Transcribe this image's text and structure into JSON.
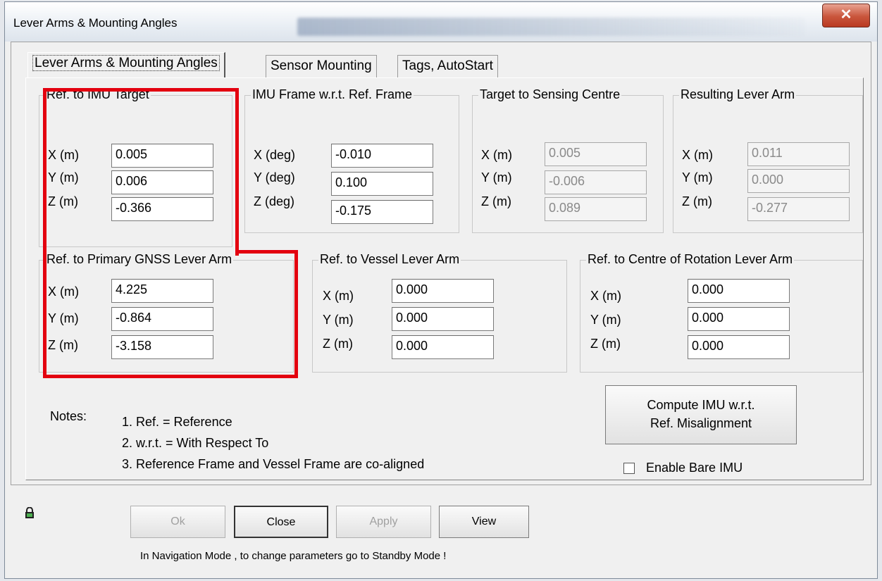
{
  "window": {
    "title": "Lever Arms & Mounting Angles",
    "close_glyph": "✕"
  },
  "tabs": [
    {
      "label": "Lever Arms & Mounting Angles"
    },
    {
      "label": "Sensor Mounting"
    },
    {
      "label": "Tags, AutoStart"
    }
  ],
  "groups": {
    "ref_imu_target": {
      "title": "Ref. to IMU Target",
      "rows": [
        {
          "label": "X (m)",
          "value": "0.005"
        },
        {
          "label": "Y (m)",
          "value": "0.006"
        },
        {
          "label": "Z (m)",
          "value": "-0.366"
        }
      ]
    },
    "imu_frame": {
      "title": "IMU Frame w.r.t. Ref. Frame",
      "rows": [
        {
          "label": "X (deg)",
          "value": "-0.010"
        },
        {
          "label": "Y (deg)",
          "value": "0.100"
        },
        {
          "label": "Z (deg)",
          "value": "-0.175"
        }
      ]
    },
    "target_sensing": {
      "title": "Target to Sensing Centre",
      "rows": [
        {
          "label": "X (m)",
          "value": "0.005"
        },
        {
          "label": "Y (m)",
          "value": "-0.006"
        },
        {
          "label": "Z (m)",
          "value": "0.089"
        }
      ]
    },
    "resulting_lever": {
      "title": "Resulting Lever Arm",
      "rows": [
        {
          "label": "X (m)",
          "value": "0.011"
        },
        {
          "label": "Y (m)",
          "value": "0.000"
        },
        {
          "label": "Z (m)",
          "value": "-0.277"
        }
      ]
    },
    "primary_gnss": {
      "title": "Ref. to Primary GNSS Lever Arm",
      "rows": [
        {
          "label": "X (m)",
          "value": "4.225"
        },
        {
          "label": "Y (m)",
          "value": "-0.864"
        },
        {
          "label": "Z (m)",
          "value": "-3.158"
        }
      ]
    },
    "vessel_lever": {
      "title": "Ref. to Vessel Lever Arm",
      "rows": [
        {
          "label": "X (m)",
          "value": "0.000"
        },
        {
          "label": "Y (m)",
          "value": "0.000"
        },
        {
          "label": "Z (m)",
          "value": "0.000"
        }
      ]
    },
    "centre_rotation": {
      "title": "Ref. to Centre of Rotation Lever Arm",
      "rows": [
        {
          "label": "X (m)",
          "value": "0.000"
        },
        {
          "label": "Y (m)",
          "value": "0.000"
        },
        {
          "label": "Z (m)",
          "value": "0.000"
        }
      ]
    }
  },
  "notes": {
    "heading": "Notes:",
    "items": [
      "1. Ref. = Reference",
      "2. w.r.t. = With Respect To",
      "3. Reference Frame and Vessel Frame are co-aligned"
    ]
  },
  "compute_button": {
    "line1": "Compute IMU w.r.t.",
    "line2": "Ref. Misalignment"
  },
  "enable_bare_imu": {
    "label": "Enable Bare IMU",
    "checked": false
  },
  "buttons": {
    "ok": "Ok",
    "close": "Close",
    "apply": "Apply",
    "view": "View"
  },
  "status_message": "In Navigation Mode , to change parameters go to Standby Mode !",
  "colors": {
    "highlight": "#e3000f",
    "title_close": "#c9553c"
  }
}
